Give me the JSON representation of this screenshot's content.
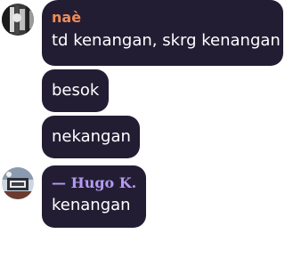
{
  "messages": [
    {
      "author": "naè",
      "text": "td kenangan, skrg kenangan",
      "avatar": "avatar-icon"
    },
    {
      "text": "besok"
    },
    {
      "text": "nekangan"
    },
    {
      "author": "— Hugo K.",
      "text": "kenangan",
      "avatar": "avatar-icon"
    }
  ],
  "colors": {
    "bubble": "#231d34",
    "text": "#ffffff",
    "author_nae": "#f08b54",
    "author_hugo": "#b49bf0"
  }
}
